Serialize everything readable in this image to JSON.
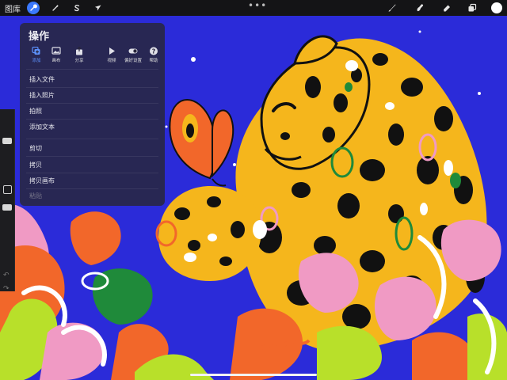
{
  "topbar": {
    "gallery_label": "图库",
    "tools_left": [
      {
        "icon": "wrench-icon",
        "active": true
      },
      {
        "icon": "magic-wand-icon",
        "active": false
      },
      {
        "icon": "selection-s-icon",
        "active": false
      },
      {
        "icon": "arrow-cursor-icon",
        "active": false
      }
    ],
    "more_dots": "•••",
    "tools_right": [
      {
        "icon": "brush-icon"
      },
      {
        "icon": "smudge-icon"
      },
      {
        "icon": "eraser-icon"
      },
      {
        "icon": "layers-icon"
      },
      {
        "icon": "color-icon"
      }
    ],
    "color_value": "#ffffff"
  },
  "actions_panel": {
    "title": "操作",
    "tabs": [
      {
        "label": "添加",
        "icon": "add-icon",
        "active": true
      },
      {
        "label": "画布",
        "icon": "canvas-icon",
        "active": false
      },
      {
        "label": "分享",
        "icon": "share-icon",
        "active": false
      },
      {
        "label": "视频",
        "icon": "play-icon",
        "active": false
      },
      {
        "label": "偏好设置",
        "icon": "toggle-icon",
        "active": false
      },
      {
        "label": "帮助",
        "icon": "help-icon",
        "active": false
      }
    ],
    "menu_items": [
      {
        "label": "插入文件",
        "disabled": false
      },
      {
        "label": "插入照片",
        "disabled": false
      },
      {
        "label": "拍照",
        "disabled": false
      },
      {
        "label": "添加文本",
        "disabled": false
      },
      {
        "label": "剪切",
        "disabled": false
      },
      {
        "label": "拷贝",
        "disabled": false
      },
      {
        "label": "拷贝画布",
        "disabled": false
      },
      {
        "label": "粘贴",
        "disabled": true
      }
    ]
  },
  "sidebar": {
    "size_slider_value": 0.2,
    "opacity_slider_value": 0.4,
    "undo_icon": "undo-icon",
    "redo_icon": "redo-icon"
  },
  "colors": {
    "accent": "#3b79ff",
    "canvas_bg": "#2b2bd9",
    "leopard_yellow": "#f5b61c",
    "orange": "#f2672a",
    "green": "#1f8a3a",
    "pink": "#f09ac4",
    "lime": "#b8e02a"
  }
}
